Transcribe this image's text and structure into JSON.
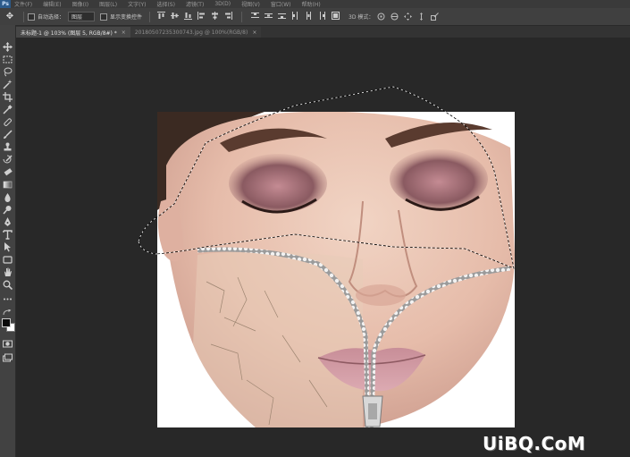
{
  "app": {
    "logo": "Ps",
    "menus": [
      "文件(F)",
      "编辑(E)",
      "图像(I)",
      "图层(L)",
      "文字(Y)",
      "选择(S)",
      "滤镜(T)",
      "3D(D)",
      "视图(V)",
      "窗口(W)",
      "帮助(H)"
    ]
  },
  "options": {
    "auto_select_label": "自动选择：",
    "auto_select_value": "图层",
    "show_transform_label": "显示变换控件",
    "mode_3d_label": "3D 模式："
  },
  "tabs": [
    {
      "label": "未标题-1 @ 103% (图层 5, RGB/8#) *",
      "close": "×"
    },
    {
      "label": "20180507235300743.jpg @ 100%(RGB/8)",
      "close": "×"
    }
  ],
  "tools": [
    "move-icon",
    "marquee-icon",
    "lasso-icon",
    "magic-wand-icon",
    "crop-icon",
    "eyedropper-icon",
    "healing-brush-icon",
    "brush-icon",
    "clone-stamp-icon",
    "history-brush-icon",
    "eraser-icon",
    "gradient-icon",
    "blur-icon",
    "dodge-icon",
    "pen-icon",
    "type-icon",
    "path-selection-icon",
    "shape-icon",
    "hand-icon",
    "zoom-icon",
    "more-tools-icon"
  ],
  "colors": {
    "foreground": "#0a0a0a",
    "background": "#ffffff",
    "workspace": "#282828"
  },
  "watermark": "UiBQ.CoM"
}
